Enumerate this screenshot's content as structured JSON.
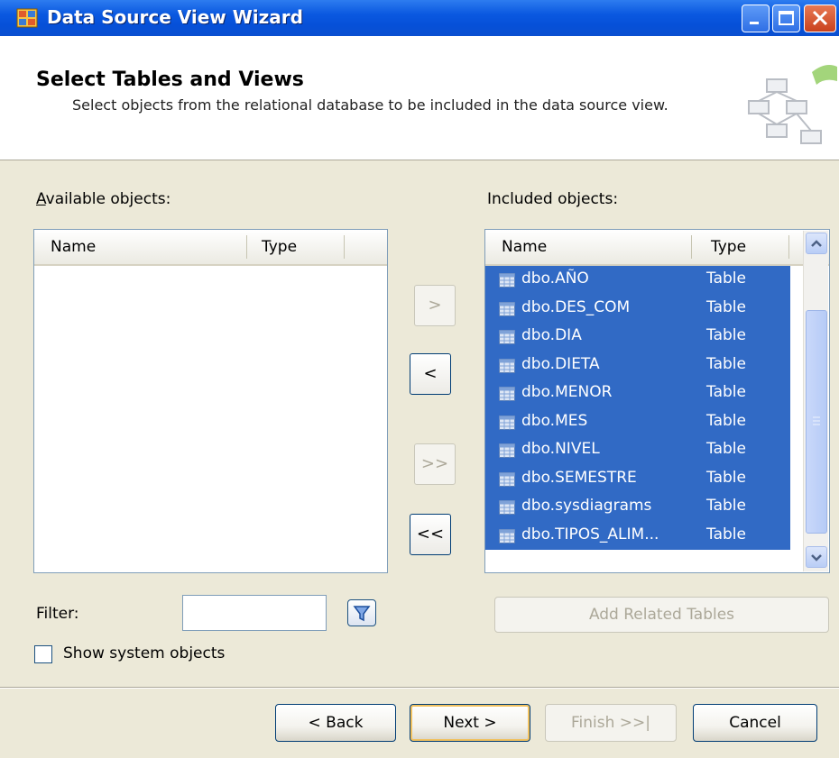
{
  "window": {
    "title": "Data Source View Wizard"
  },
  "header": {
    "title": "Select Tables and Views",
    "description": "Select objects from the relational database to be included in the data source view."
  },
  "available": {
    "label_prefix": "A",
    "label_rest": "vailable objects:",
    "columns": [
      "Name",
      "Type"
    ]
  },
  "included": {
    "label": "Included objects:",
    "columns": [
      "Name",
      "Type"
    ],
    "rows": [
      {
        "name": "dbo.AÑO",
        "type": "Table"
      },
      {
        "name": "dbo.DES_COM",
        "type": "Table"
      },
      {
        "name": "dbo.DIA",
        "type": "Table"
      },
      {
        "name": "dbo.DIETA",
        "type": "Table"
      },
      {
        "name": "dbo.MENOR",
        "type": "Table"
      },
      {
        "name": "dbo.MES",
        "type": "Table"
      },
      {
        "name": "dbo.NIVEL",
        "type": "Table"
      },
      {
        "name": "dbo.SEMESTRE",
        "type": "Table"
      },
      {
        "name": "dbo.sysdiagrams",
        "type": "Table"
      },
      {
        "name": "dbo.TIPOS_ALIM...",
        "type": "Table"
      }
    ]
  },
  "transfer": {
    "add": ">",
    "remove": "<",
    "add_all": ">>",
    "remove_all": "<<"
  },
  "filter": {
    "label": "Filter:",
    "value": ""
  },
  "show_system": {
    "label": "Show system objects",
    "checked": false
  },
  "add_related_label": "Add Related Tables",
  "footer": {
    "back": "< Back",
    "next": "Next >",
    "finish": "Finish >>|",
    "cancel": "Cancel"
  },
  "colors": {
    "selection": "#316AC5",
    "titlebar": "#0A58E0",
    "background": "#ECE9D8"
  }
}
